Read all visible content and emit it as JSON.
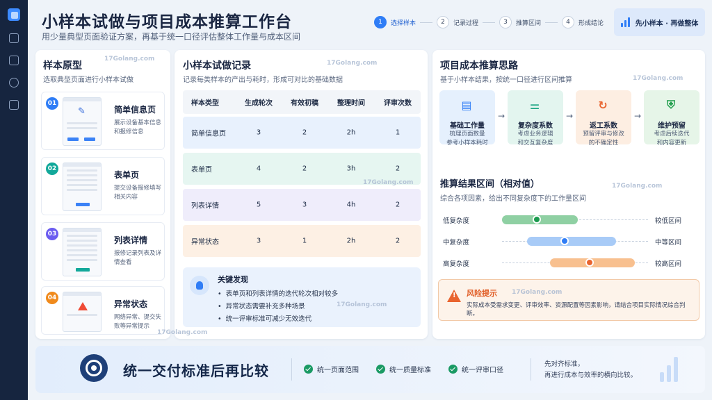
{
  "header": {
    "title": "小样本试做与项目成本推算工作台",
    "subtitle": "用少量典型页面验证方案，再基于统一口径评估整体工作量与成本区间",
    "steps": [
      {
        "num": "1",
        "label": "选择样本"
      },
      {
        "num": "2",
        "label": "记录过程"
      },
      {
        "num": "3",
        "label": "推算区间"
      },
      {
        "num": "4",
        "label": "形成结论"
      }
    ],
    "badge": "先小样本 · 再做整体"
  },
  "samples_panel": {
    "title": "样本原型",
    "subtitle": "选取典型页面进行小样本试做",
    "items": [
      {
        "num": "01",
        "name": "简单信息页",
        "desc": "展示设备基本信息和报修信息",
        "color": "#2f7df6"
      },
      {
        "num": "02",
        "name": "表单页",
        "desc": "提交设备报修填写相关内容",
        "color": "#12a89a"
      },
      {
        "num": "03",
        "name": "列表详情",
        "desc": "报修记录列表及详情查看",
        "color": "#6b5cf0"
      },
      {
        "num": "04",
        "name": "异常状态",
        "desc": "网络异常、提交失败等异常提示",
        "color": "#f08a1c"
      }
    ]
  },
  "record_panel": {
    "title": "小样本试做记录",
    "subtitle": "记录每类样本的产出与耗时，形成可对比的基础数据",
    "columns": [
      "样本类型",
      "生成轮次",
      "有效初稿",
      "整理时间",
      "评审次数"
    ],
    "rows": [
      {
        "type": "简单信息页",
        "rounds": "3",
        "drafts": "2",
        "time": "2h",
        "reviews": "1",
        "bg": "#e8f1fd"
      },
      {
        "type": "表单页",
        "rounds": "4",
        "drafts": "2",
        "time": "3h",
        "reviews": "2",
        "bg": "#e6f6f1"
      },
      {
        "type": "列表详情",
        "rounds": "5",
        "drafts": "3",
        "time": "4h",
        "reviews": "2",
        "bg": "#efedfb"
      },
      {
        "type": "异常状态",
        "rounds": "3",
        "drafts": "1",
        "time": "2h",
        "reviews": "2",
        "bg": "#fdf0e4"
      }
    ],
    "findings": {
      "title": "关键发现",
      "items": [
        "表单页和列表详情的迭代轮次相对较多",
        "异常状态需要补充多种场景",
        "统一评审标准可减少无效迭代"
      ]
    }
  },
  "estimate_panel": {
    "title": "项目成本推算思路",
    "subtitle": "基于小样本结果，按统一口径进行区间推算",
    "factors": [
      {
        "name": "基础工作量",
        "desc1": "梳理页面数量",
        "desc2": "参考小样本耗时",
        "bg": "#e5f0fd",
        "color": "#2f7df6",
        "icon": "doc-icon"
      },
      {
        "name": "复杂度系数",
        "desc1": "考虑业务逻辑",
        "desc2": "和交互复杂度",
        "bg": "#e3f5ef",
        "color": "#14a37f",
        "icon": "sliders-icon"
      },
      {
        "name": "返工系数",
        "desc1": "预留评审与修改",
        "desc2": "的不确定性",
        "bg": "#fdeee2",
        "color": "#e9642f",
        "icon": "refresh-icon"
      },
      {
        "name": "维护预留",
        "desc1": "考虑后续迭代",
        "desc2": "和内容更新",
        "bg": "#e6f5e8",
        "color": "#1f9d4b",
        "icon": "shield-icon"
      }
    ],
    "range": {
      "title": "推算结果区间（相对值）",
      "subtitle": "综合各项因素，给出不同复杂度下的工作量区间",
      "rows": [
        {
          "label": "低复杂度",
          "result": "较低区间",
          "start": 0.0,
          "end": 0.52,
          "dot": 0.24,
          "bar": "#8fd0a3",
          "dotc": "#1b9a4e"
        },
        {
          "label": "中复杂度",
          "result": "中等区间",
          "start": 0.17,
          "end": 0.78,
          "dot": 0.43,
          "bar": "#a8cbf7",
          "dotc": "#2f7df6"
        },
        {
          "label": "高复杂度",
          "result": "较高区间",
          "start": 0.33,
          "end": 0.91,
          "dot": 0.6,
          "bar": "#f8c08f",
          "dotc": "#e9642f"
        }
      ]
    },
    "risk": {
      "title": "风险提示",
      "desc": "实际成本受需求变更、评审效率、资源配置等因素影响，请结合项目实际情况综合判断。"
    }
  },
  "banner": {
    "title": "统一交付标准后再比较",
    "checks": [
      "统一页面范围",
      "统一质量标准",
      "统一评审口径"
    ],
    "note1": "先对齐标准，",
    "note2": "再进行成本与效率的横向比较。"
  },
  "watermark": "17Golang.com"
}
